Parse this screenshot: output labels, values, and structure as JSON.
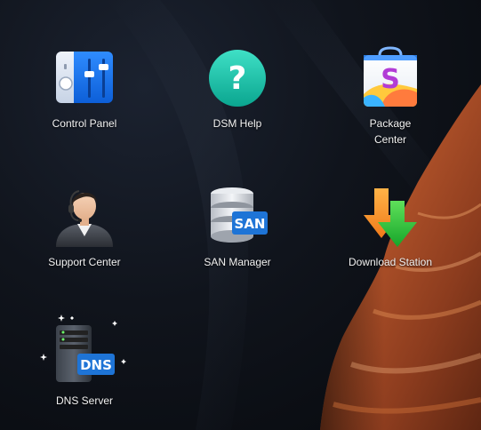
{
  "desktop": {
    "apps": [
      {
        "id": "control-panel",
        "label": "Control Panel"
      },
      {
        "id": "dsm-help",
        "label": "DSM Help"
      },
      {
        "id": "package-center",
        "label_line1": "Package",
        "label_line2": "Center"
      },
      {
        "id": "support-center",
        "label": "Support Center"
      },
      {
        "id": "san-manager",
        "label": "SAN Manager",
        "badge": "SAN"
      },
      {
        "id": "download-station",
        "label": "Download Station"
      },
      {
        "id": "dns-server",
        "label": "DNS Server",
        "badge": "DNS"
      }
    ],
    "help_glyph": "?",
    "package_glyph": "S"
  },
  "colors": {
    "wallpaper_dark": "#0c0f15",
    "rock_orange": "#b5552b",
    "label_text": "#f2f2f2"
  }
}
